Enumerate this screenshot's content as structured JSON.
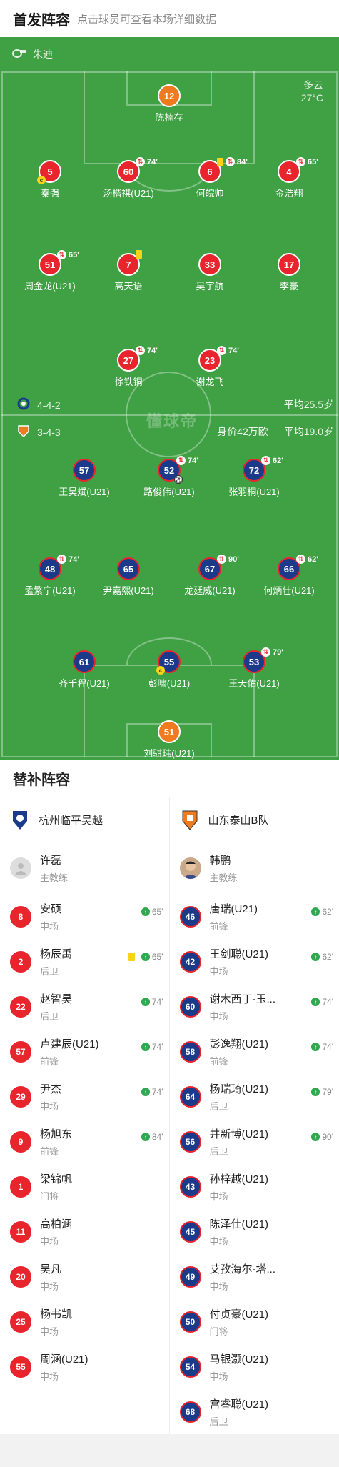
{
  "header": {
    "title": "首发阵容",
    "subtitle": "点击球员可查看本场详细数据"
  },
  "pitch": {
    "referee": "朱迪",
    "weather": "多云",
    "temperature": "27°C",
    "home": {
      "formation": "4-4-2",
      "avg_age": "平均25.5岁"
    },
    "away": {
      "formation": "3-4-3",
      "value": "身价42万欧",
      "avg_age": "平均19.0岁"
    },
    "watermark": "懂球帝"
  },
  "home_players": [
    {
      "num": "12",
      "name": "陈楠存",
      "color": "orange"
    },
    {
      "num": "5",
      "name": "秦强",
      "captain": "c"
    },
    {
      "num": "60",
      "name": "汤楷祺(U21)",
      "sub": "74'"
    },
    {
      "num": "6",
      "name": "何皖帅",
      "card": true,
      "sub": "84'"
    },
    {
      "num": "4",
      "name": "金浩翔",
      "sub": "65'"
    },
    {
      "num": "51",
      "name": "周金龙(U21)",
      "sub": "65'"
    },
    {
      "num": "7",
      "name": "高天语",
      "card": true
    },
    {
      "num": "33",
      "name": "吴宇航"
    },
    {
      "num": "17",
      "name": "李豪"
    },
    {
      "num": "27",
      "name": "徐铁铜",
      "sub": "74'"
    },
    {
      "num": "23",
      "name": "谢龙飞",
      "sub": "74'"
    }
  ],
  "away_players": [
    {
      "num": "57",
      "name": "王昊斌(U21)"
    },
    {
      "num": "52",
      "name": "路俊伟(U21)",
      "sub": "74'",
      "goal": true
    },
    {
      "num": "72",
      "name": "张羽桐(U21)",
      "sub": "62'"
    },
    {
      "num": "48",
      "name": "孟繁宁(U21)",
      "sub": "74'"
    },
    {
      "num": "65",
      "name": "尹嘉熙(U21)"
    },
    {
      "num": "67",
      "name": "龙廷威(U21)",
      "sub": "90'"
    },
    {
      "num": "66",
      "name": "何炳壮(U21)",
      "sub": "62'"
    },
    {
      "num": "61",
      "name": "齐千程(U21)"
    },
    {
      "num": "55",
      "name": "彭啸(U21)",
      "captain": "c"
    },
    {
      "num": "53",
      "name": "王天佑(U21)",
      "sub": "79'"
    },
    {
      "num": "51",
      "name": "刘骐玮(U21)",
      "color": "orange"
    }
  ],
  "subs": {
    "title": "替补阵容",
    "home": {
      "team": "杭州临平吴越",
      "coach": {
        "name": "许磊",
        "role": "主教练"
      },
      "players": [
        {
          "num": "8",
          "name": "安硕",
          "pos": "中场",
          "minute": "65'"
        },
        {
          "num": "2",
          "name": "杨辰禹",
          "pos": "后卫",
          "minute": "65'",
          "card": true
        },
        {
          "num": "22",
          "name": "赵智昊",
          "pos": "后卫",
          "minute": "74'"
        },
        {
          "num": "57",
          "name": "卢建辰(U21)",
          "pos": "前锋",
          "minute": "74'"
        },
        {
          "num": "29",
          "name": "尹杰",
          "pos": "中场",
          "minute": "74'"
        },
        {
          "num": "9",
          "name": "杨旭东",
          "pos": "前锋",
          "minute": "84'"
        },
        {
          "num": "1",
          "name": "梁锦帆",
          "pos": "门将",
          "minute": ""
        },
        {
          "num": "11",
          "name": "高柏涵",
          "pos": "中场",
          "minute": ""
        },
        {
          "num": "20",
          "name": "吴凡",
          "pos": "中场",
          "minute": ""
        },
        {
          "num": "25",
          "name": "杨书凯",
          "pos": "中场",
          "minute": ""
        },
        {
          "num": "55",
          "name": "周涵(U21)",
          "pos": "中场",
          "minute": ""
        }
      ]
    },
    "away": {
      "team": "山东泰山B队",
      "coach": {
        "name": "韩鹏",
        "role": "主教练"
      },
      "players": [
        {
          "num": "46",
          "name": "唐瑞(U21)",
          "pos": "前锋",
          "minute": "62'"
        },
        {
          "num": "42",
          "name": "王剑聪(U21)",
          "pos": "中场",
          "minute": "62'"
        },
        {
          "num": "60",
          "name": "谢木西丁-玉...",
          "pos": "中场",
          "minute": "74'"
        },
        {
          "num": "58",
          "name": "彭逸翔(U21)",
          "pos": "前锋",
          "minute": "74'"
        },
        {
          "num": "64",
          "name": "杨瑞琦(U21)",
          "pos": "后卫",
          "minute": "79'"
        },
        {
          "num": "56",
          "name": "井新博(U21)",
          "pos": "后卫",
          "minute": "90'"
        },
        {
          "num": "43",
          "name": "孙梓越(U21)",
          "pos": "中场",
          "minute": ""
        },
        {
          "num": "45",
          "name": "陈泽仕(U21)",
          "pos": "中场",
          "minute": ""
        },
        {
          "num": "49",
          "name": "艾孜海尔-塔...",
          "pos": "中场",
          "minute": ""
        },
        {
          "num": "50",
          "name": "付贞豪(U21)",
          "pos": "门将",
          "minute": ""
        },
        {
          "num": "54",
          "name": "马银灏(U21)",
          "pos": "中场",
          "minute": ""
        },
        {
          "num": "68",
          "name": "宫睿聪(U21)",
          "pos": "后卫",
          "minute": ""
        }
      ]
    }
  }
}
